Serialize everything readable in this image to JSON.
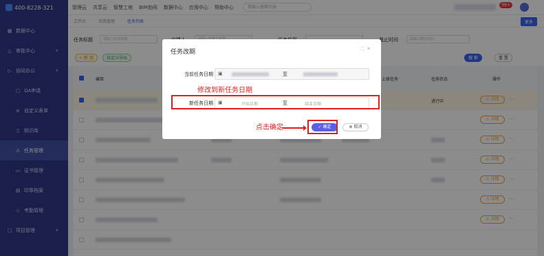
{
  "sidebar": {
    "phone": "400-8228-321",
    "items": [
      {
        "label": "数据中心",
        "icon": "grid-icon"
      },
      {
        "label": "审批中心",
        "icon": "warning-icon"
      },
      {
        "label": "协同办公",
        "icon": "arrow-icon"
      },
      {
        "label": "OA申请",
        "icon": "doc-icon"
      },
      {
        "label": "自定义表单",
        "icon": "form-icon"
      },
      {
        "label": "知识库",
        "icon": "book-icon"
      },
      {
        "label": "任务管理",
        "icon": "task-icon"
      },
      {
        "label": "证书管理",
        "icon": "cert-icon"
      },
      {
        "label": "印章档案",
        "icon": "seal-icon"
      },
      {
        "label": "考勤管理",
        "icon": "location-icon"
      },
      {
        "label": "项目管理",
        "icon": "project-icon"
      }
    ]
  },
  "topbar": {
    "nav": [
      "管理云",
      "共享云",
      "智慧工地",
      "BIM协同",
      "数据中心",
      "应用中心",
      "帮助中心"
    ],
    "search_placeholder": "请输入搜索内容",
    "badge": "99+"
  },
  "tabs": {
    "items": [
      "工作台",
      "资质管理",
      "任务列表"
    ],
    "more": "更多"
  },
  "filters": {
    "title_label": "任务标题",
    "title_placeholder": "请输入任务标题",
    "creator_label": "创建人",
    "creator_placeholder": "请输入创建人名称",
    "file_label": "任务档案",
    "deadline_label": "截止时间",
    "deadline_placeholder": "请输入截止时间"
  },
  "actions": {
    "add": "+ 新 增",
    "export": "自定义导出",
    "search": "搜 索",
    "reset": "重 置"
  },
  "table": {
    "headers": [
      "编目",
      "上级任务",
      "任务状态",
      "操作"
    ],
    "status_first": "进行中",
    "detail": "详情"
  },
  "modal": {
    "title": "任务改期",
    "current_label": "当前任务日期",
    "new_label": "新任务日期",
    "separator": "至",
    "start_placeholder": "开始日期",
    "end_placeholder": "结束日期",
    "ok": "确定",
    "cancel": "取消"
  },
  "annotations": {
    "modify": "修改到新任务日期",
    "confirm": "点击确定"
  },
  "colors": {
    "sidebar_bg": "#2f3a88",
    "primary": "#3a63f3",
    "annotation": "#e02020",
    "detail": "#f2a03d"
  }
}
